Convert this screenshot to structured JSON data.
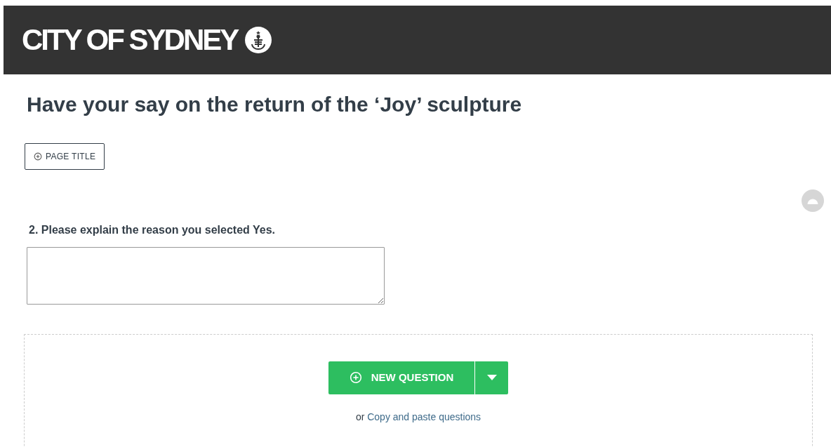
{
  "header": {
    "logo_text": "CITY OF SYDNEY"
  },
  "page": {
    "title": "Have your say on the return of the ‘Joy’ sculpture",
    "page_title_button": "PAGE TITLE"
  },
  "question": {
    "label": "2. Please explain the reason you selected Yes."
  },
  "add_question": {
    "button": "NEW QUESTION",
    "prefix": "or",
    "link": "Copy and paste questions"
  }
}
